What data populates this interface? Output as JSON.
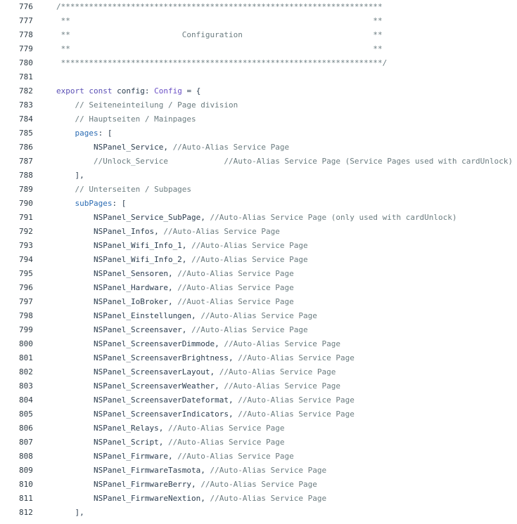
{
  "editor": {
    "lines": [
      {
        "n": "776",
        "parts": [
          {
            "t": "/*********************************************************************",
            "c": "comment"
          }
        ]
      },
      {
        "n": "777",
        "parts": [
          {
            "t": " **                                                                 **",
            "c": "comment"
          }
        ]
      },
      {
        "n": "778",
        "parts": [
          {
            "t": " **                        Configuration                            **",
            "c": "comment"
          }
        ]
      },
      {
        "n": "779",
        "parts": [
          {
            "t": " **                                                                 **",
            "c": "comment"
          }
        ]
      },
      {
        "n": "780",
        "parts": [
          {
            "t": " *********************************************************************/",
            "c": "comment"
          }
        ]
      },
      {
        "n": "781",
        "parts": []
      },
      {
        "n": "782",
        "parts": [
          {
            "t": "export const ",
            "c": "keyword"
          },
          {
            "t": "config",
            "c": "ident"
          },
          {
            "t": ": ",
            "c": "punct"
          },
          {
            "t": "Config",
            "c": "type"
          },
          {
            "t": " = {",
            "c": "punct"
          }
        ]
      },
      {
        "n": "783",
        "parts": [
          {
            "t": "    // Seiteneinteilung / Page division",
            "c": "comment"
          }
        ]
      },
      {
        "n": "784",
        "parts": [
          {
            "t": "    // Hauptseiten / Mainpages",
            "c": "comment"
          }
        ]
      },
      {
        "n": "785",
        "parts": [
          {
            "t": "    ",
            "c": "punct"
          },
          {
            "t": "pages",
            "c": "prop"
          },
          {
            "t": ": [",
            "c": "punct"
          }
        ]
      },
      {
        "n": "786",
        "parts": [
          {
            "t": "        NSPanel_Service, ",
            "c": "ident"
          },
          {
            "t": "//Auto-Alias Service Page",
            "c": "comment"
          }
        ]
      },
      {
        "n": "787",
        "parts": [
          {
            "t": "        //Unlock_Service            //Auto-Alias Service Page (Service Pages used with cardUnlock)",
            "c": "comment"
          }
        ]
      },
      {
        "n": "788",
        "parts": [
          {
            "t": "    ],",
            "c": "punct"
          }
        ]
      },
      {
        "n": "789",
        "parts": [
          {
            "t": "    // Unterseiten / Subpages",
            "c": "comment"
          }
        ]
      },
      {
        "n": "790",
        "parts": [
          {
            "t": "    ",
            "c": "punct"
          },
          {
            "t": "subPages",
            "c": "prop"
          },
          {
            "t": ": [",
            "c": "punct"
          }
        ]
      },
      {
        "n": "791",
        "parts": [
          {
            "t": "        NSPanel_Service_SubPage, ",
            "c": "ident"
          },
          {
            "t": "//Auto-Alias Service Page (only used with cardUnlock)",
            "c": "comment"
          }
        ]
      },
      {
        "n": "792",
        "parts": [
          {
            "t": "        NSPanel_Infos, ",
            "c": "ident"
          },
          {
            "t": "//Auto-Alias Service Page",
            "c": "comment"
          }
        ]
      },
      {
        "n": "793",
        "parts": [
          {
            "t": "        NSPanel_Wifi_Info_1, ",
            "c": "ident"
          },
          {
            "t": "//Auto-Alias Service Page",
            "c": "comment"
          }
        ]
      },
      {
        "n": "794",
        "parts": [
          {
            "t": "        NSPanel_Wifi_Info_2, ",
            "c": "ident"
          },
          {
            "t": "//Auto-Alias Service Page",
            "c": "comment"
          }
        ]
      },
      {
        "n": "795",
        "parts": [
          {
            "t": "        NSPanel_Sensoren, ",
            "c": "ident"
          },
          {
            "t": "//Auto-Alias Service Page",
            "c": "comment"
          }
        ]
      },
      {
        "n": "796",
        "parts": [
          {
            "t": "        NSPanel_Hardware, ",
            "c": "ident"
          },
          {
            "t": "//Auto-Alias Service Page",
            "c": "comment"
          }
        ]
      },
      {
        "n": "797",
        "parts": [
          {
            "t": "        NSPanel_IoBroker, ",
            "c": "ident"
          },
          {
            "t": "//Auot-Alias Service Page",
            "c": "comment"
          }
        ]
      },
      {
        "n": "798",
        "parts": [
          {
            "t": "        NSPanel_Einstellungen, ",
            "c": "ident"
          },
          {
            "t": "//Auto-Alias Service Page",
            "c": "comment"
          }
        ]
      },
      {
        "n": "799",
        "parts": [
          {
            "t": "        NSPanel_Screensaver, ",
            "c": "ident"
          },
          {
            "t": "//Auto-Alias Service Page",
            "c": "comment"
          }
        ]
      },
      {
        "n": "800",
        "parts": [
          {
            "t": "        NSPanel_ScreensaverDimmode, ",
            "c": "ident"
          },
          {
            "t": "//Auto-Alias Service Page",
            "c": "comment"
          }
        ]
      },
      {
        "n": "801",
        "parts": [
          {
            "t": "        NSPanel_ScreensaverBrightness, ",
            "c": "ident"
          },
          {
            "t": "//Auto-Alias Service Page",
            "c": "comment"
          }
        ]
      },
      {
        "n": "802",
        "parts": [
          {
            "t": "        NSPanel_ScreensaverLayout, ",
            "c": "ident"
          },
          {
            "t": "//Auto-Alias Service Page",
            "c": "comment"
          }
        ]
      },
      {
        "n": "803",
        "parts": [
          {
            "t": "        NSPanel_ScreensaverWeather, ",
            "c": "ident"
          },
          {
            "t": "//Auto-Alias Service Page",
            "c": "comment"
          }
        ]
      },
      {
        "n": "804",
        "parts": [
          {
            "t": "        NSPanel_ScreensaverDateformat, ",
            "c": "ident"
          },
          {
            "t": "//Auto-Alias Service Page",
            "c": "comment"
          }
        ]
      },
      {
        "n": "805",
        "parts": [
          {
            "t": "        NSPanel_ScreensaverIndicators, ",
            "c": "ident"
          },
          {
            "t": "//Auto-Alias Service Page",
            "c": "comment"
          }
        ]
      },
      {
        "n": "806",
        "parts": [
          {
            "t": "        NSPanel_Relays, ",
            "c": "ident"
          },
          {
            "t": "//Auto-Alias Service Page",
            "c": "comment"
          }
        ]
      },
      {
        "n": "807",
        "parts": [
          {
            "t": "        NSPanel_Script, ",
            "c": "ident"
          },
          {
            "t": "//Auto-Alias Service Page",
            "c": "comment"
          }
        ]
      },
      {
        "n": "808",
        "parts": [
          {
            "t": "        NSPanel_Firmware, ",
            "c": "ident"
          },
          {
            "t": "//Auto-Alias Service Page",
            "c": "comment"
          }
        ]
      },
      {
        "n": "809",
        "parts": [
          {
            "t": "        NSPanel_FirmwareTasmota, ",
            "c": "ident"
          },
          {
            "t": "//Auto-Alias Service Page",
            "c": "comment"
          }
        ]
      },
      {
        "n": "810",
        "parts": [
          {
            "t": "        NSPanel_FirmwareBerry, ",
            "c": "ident"
          },
          {
            "t": "//Auto-Alias Service Page",
            "c": "comment"
          }
        ]
      },
      {
        "n": "811",
        "parts": [
          {
            "t": "        NSPanel_FirmwareNextion, ",
            "c": "ident"
          },
          {
            "t": "//Auto-Alias Service Page",
            "c": "comment"
          }
        ]
      },
      {
        "n": "812",
        "parts": [
          {
            "t": "    ],",
            "c": "punct"
          }
        ]
      }
    ],
    "colors": {
      "comment": "#6b7c80",
      "keyword": "#5a4fb5",
      "type": "#6a4fc5",
      "property": "#2a6bb3",
      "text": "#2c3e50",
      "line_number": "#2e3b45"
    }
  }
}
